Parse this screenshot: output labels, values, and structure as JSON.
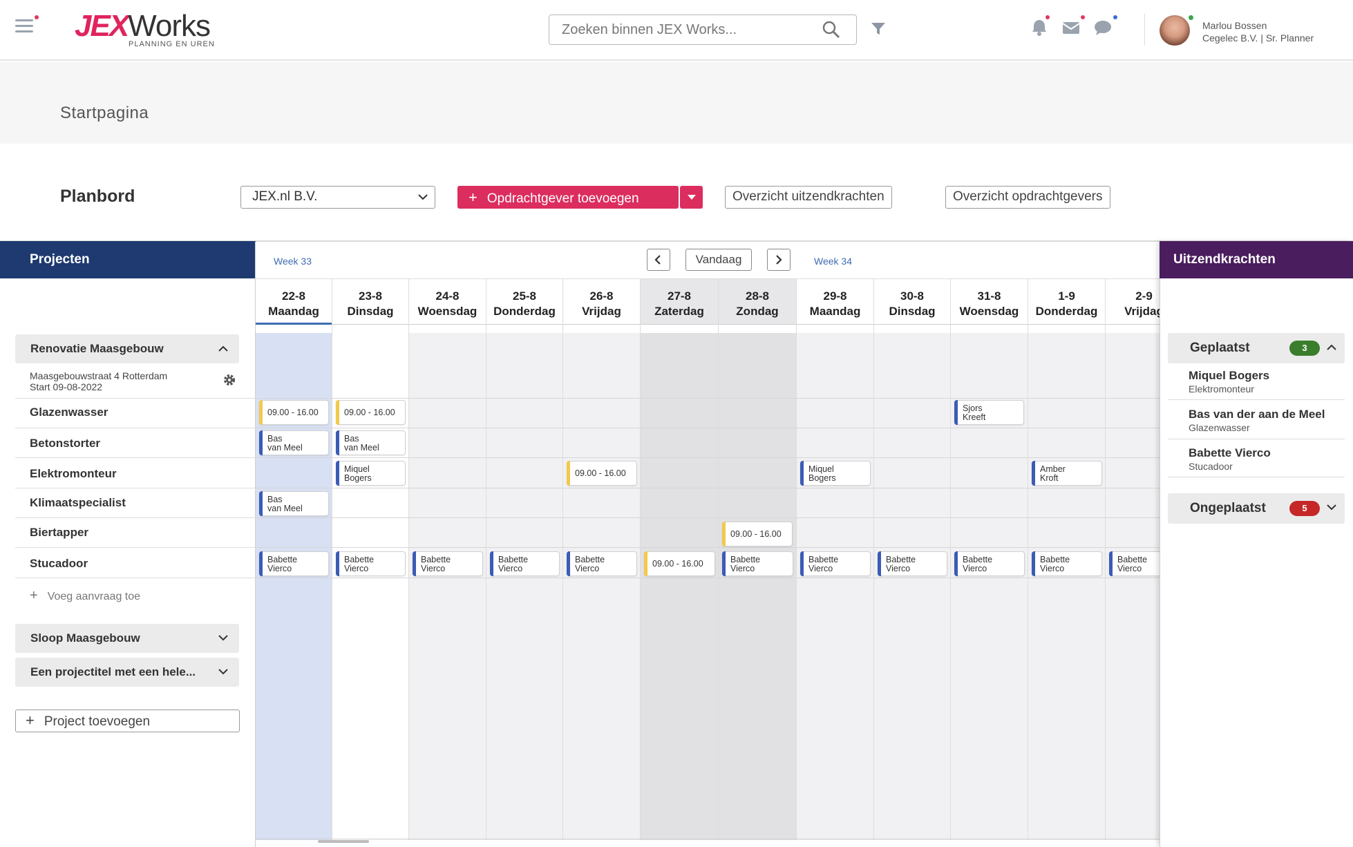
{
  "header": {
    "logo_jex": "JEX",
    "logo_works": "Works",
    "logo_sub": "PLANNING EN UREN",
    "search_placeholder": "Zoeken binnen JEX Works...",
    "user_name": "Marlou Bossen",
    "user_org": "Cegelec B.V. | Sr. Planner"
  },
  "page": {
    "title": "Startpagina",
    "section": "Planbord",
    "client_select": "JEX.nl B.V.",
    "add_client_label": "Opdrachtgever toevoegen",
    "overview_temps": "Overzicht uitzendkrachten",
    "overview_clients": "Overzicht opdrachtgevers"
  },
  "projects_panel": {
    "title": "Projecten",
    "project": {
      "name": "Renovatie Maasgebouw",
      "address": "Maasgebouwstraat 4 Rotterdam",
      "start": "Start 09-08-2022",
      "roles": [
        "Glazenwasser",
        "Betonstorter",
        "Elektromonteur",
        "Klimaatspecialist",
        "Biertapper",
        "Stucadoor"
      ]
    },
    "add_request": "Voeg aanvraag toe",
    "other_projects": [
      "Sloop Maasgebouw",
      "Een projectitel met een hele..."
    ],
    "add_project": "Project toevoegen"
  },
  "calendar": {
    "week_prev": "Week 33",
    "today": "Vandaag",
    "week_next": "Week 34",
    "days": [
      {
        "date": "22-8",
        "name": "Maandag"
      },
      {
        "date": "23-8",
        "name": "Dinsdag"
      },
      {
        "date": "24-8",
        "name": "Woensdag"
      },
      {
        "date": "25-8",
        "name": "Donderdag"
      },
      {
        "date": "26-8",
        "name": "Vrijdag"
      },
      {
        "date": "27-8",
        "name": "Zaterdag"
      },
      {
        "date": "28-8",
        "name": "Zondag"
      },
      {
        "date": "29-8",
        "name": "Maandag"
      },
      {
        "date": "30-8",
        "name": "Dinsdag"
      },
      {
        "date": "31-8",
        "name": "Woensdag"
      },
      {
        "date": "1-9",
        "name": "Donderdag"
      },
      {
        "date": "2-9",
        "name": "Vrijdag"
      }
    ],
    "entries": {
      "time": "09.00 - 16.00",
      "bas": "Bas\nvan Meel",
      "miquel": "Miquel\nBogers",
      "sjors": "Sjors\nKreeft",
      "amber": "Amber\nKroft",
      "babette": "Babette\nVierco"
    },
    "colors": {
      "planned": "#3b5bb5",
      "open": "#f2c94c"
    }
  },
  "temps_panel": {
    "title": "Uitzendkrachten",
    "placed": {
      "label": "Geplaatst",
      "count": "3"
    },
    "people": [
      {
        "name": "Miquel Bogers",
        "role": "Elektromonteur"
      },
      {
        "name": "Bas van der aan de Meel",
        "role": "Glazenwasser"
      },
      {
        "name": "Babette Vierco",
        "role": "Stucadoor"
      }
    ],
    "unplaced": {
      "label": "Ongeplaatst",
      "count": "5"
    }
  }
}
